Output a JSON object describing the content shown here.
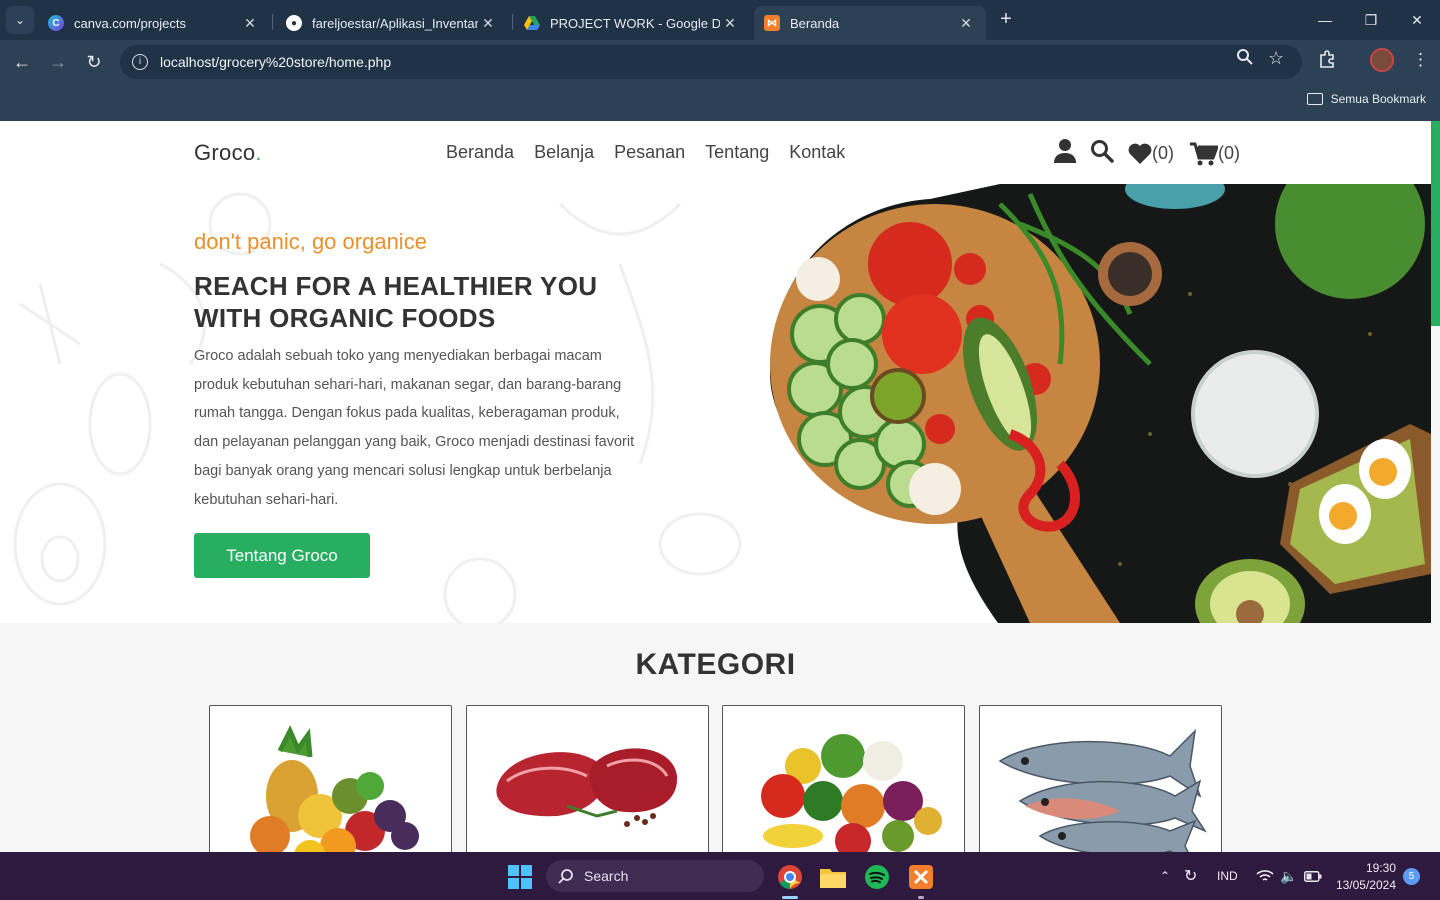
{
  "browser": {
    "tabs": [
      {
        "title": "canva.com/projects",
        "icon": "canva-icon",
        "active": false
      },
      {
        "title": "fareljoestar/Aplikasi_Inventaris...",
        "icon": "github-icon",
        "active": false
      },
      {
        "title": "PROJECT WORK - Google Drive",
        "icon": "drive-icon",
        "active": false
      },
      {
        "title": "Beranda",
        "icon": "xampp-icon",
        "active": true
      }
    ],
    "url": "localhost/grocery%20store/home.php",
    "bookmark_label": "Semua Bookmark"
  },
  "site": {
    "logo": "Groco",
    "logo_dot": ".",
    "nav": [
      "Beranda",
      "Belanja",
      "Pesanan",
      "Tentang",
      "Kontak"
    ],
    "wishlist_count": "(0)",
    "cart_count": "(0)",
    "colors": {
      "accent": "#27ae60",
      "tagline": "#e8902b"
    }
  },
  "hero": {
    "tagline": "don't panic, go organice",
    "headline": "REACH FOR A HEALTHIER YOU WITH ORGANIC FOODS",
    "description": "Groco adalah sebuah toko yang menyediakan berbagai macam produk kebutuhan sehari-hari, makanan segar, dan barang-barang rumah tangga. Dengan fokus pada kualitas, keberagaman produk, dan pelayanan pelanggan yang baik, Groco menjadi destinasi favorit bagi banyak orang yang mencari solusi lengkap untuk berbelanja kebutuhan sehari-hari.",
    "button": "Tentang Groco"
  },
  "categories": {
    "title": "KATEGORI",
    "items": [
      "fruits-image",
      "meat-image",
      "vegetables-image",
      "fish-image"
    ]
  },
  "taskbar": {
    "search_label": "Search",
    "language": "IND",
    "time": "19:30",
    "date": "13/05/2024",
    "notifications": "5"
  }
}
